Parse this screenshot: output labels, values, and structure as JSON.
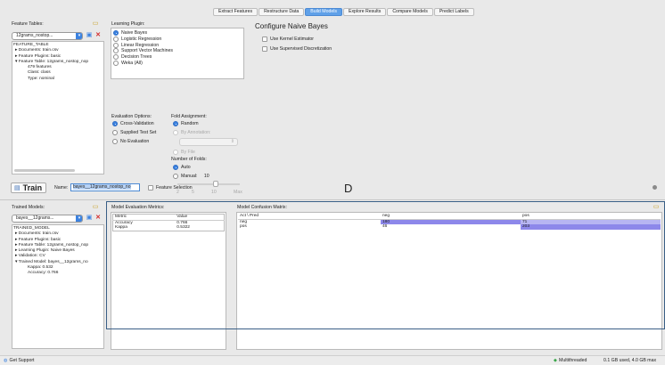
{
  "tabs": [
    "Extract Features",
    "Restructure Data",
    "Build Models",
    "Explore Results",
    "Compare Models",
    "Predict Labels"
  ],
  "active_tab": 2,
  "feature_tables": {
    "title": "Feature Tables:",
    "combo": "12grams_nostop...",
    "tree": [
      "FEATURE_TABLE",
      "▸  Documents: train.csv",
      "▸  Feature Plugins: basic",
      "▾  Feature Table: 12grams_nostop_nop",
      "479 features",
      "Class: class",
      "Type: nominal"
    ]
  },
  "learning_plugin": {
    "title": "Learning Plugin:",
    "options": [
      "Naive Bayes",
      "Logistic Regression",
      "Linear Regression",
      "Support Vector Machines",
      "Decision Trees",
      "Weka (All)"
    ],
    "selected": 0
  },
  "configure": {
    "title": "Configure Naive Bayes",
    "options": [
      "Use Kernel Estimator",
      "Use Supervised Discretization"
    ]
  },
  "evaluation": {
    "title": "Evaluation Options:",
    "options": [
      "Cross-Validation",
      "Supplied Test Set",
      "No Evaluation"
    ],
    "selected": 0
  },
  "fold": {
    "title": "Fold Assignment:",
    "options": [
      "Random",
      "By Annotation:"
    ],
    "by_file": "By File",
    "num_label": "Number of Folds:",
    "auto": "Auto",
    "manual": "Manual:",
    "manual_value": "10",
    "slider_labels": [
      "2",
      "5",
      "10",
      "Max"
    ]
  },
  "train": {
    "button": "Train",
    "name_label": "Name:",
    "name_value": "bayes__12grams_nostop_no",
    "feature_selection": "Feature Selection",
    "cursor_letter": "D"
  },
  "trained_models": {
    "title": "Trained Models:",
    "combo": "bayes__12grams...",
    "tree": [
      "TRAINED_MODEL",
      "▸  Documents: train.csv",
      "▸  Feature Plugins: basic",
      "▸  Feature Table: 12grams_nostop_nop",
      "▸  Learning Plugin: Naive Bayes",
      "▸  Validation: CV",
      "▾  Trained Model: bayes__12grams_no",
      "Kappa: 0.532",
      "Accuracy: 0.766"
    ]
  },
  "metrics": {
    "title": "Model Evaluation Metrics:",
    "headers": [
      "Metric",
      "Value"
    ],
    "rows": [
      [
        "Accuracy",
        "0.766"
      ],
      [
        "Kappa",
        "0.5322"
      ]
    ]
  },
  "confusion": {
    "title": "Model Confusion Matrix:",
    "headers": [
      "Act \\ Pred",
      "neg",
      "pos"
    ],
    "rows": [
      [
        "neg",
        "180",
        "71"
      ],
      [
        "pos",
        "46",
        "203"
      ]
    ]
  },
  "status": {
    "left": "Get Support",
    "threads": "Multithreaded",
    "memory": "0.1 GB used, 4.0 GB max"
  },
  "colors": {
    "accent": "#3b82e0",
    "highlight": "#b7b5f2",
    "highlight_dark": "#8d88ea"
  }
}
